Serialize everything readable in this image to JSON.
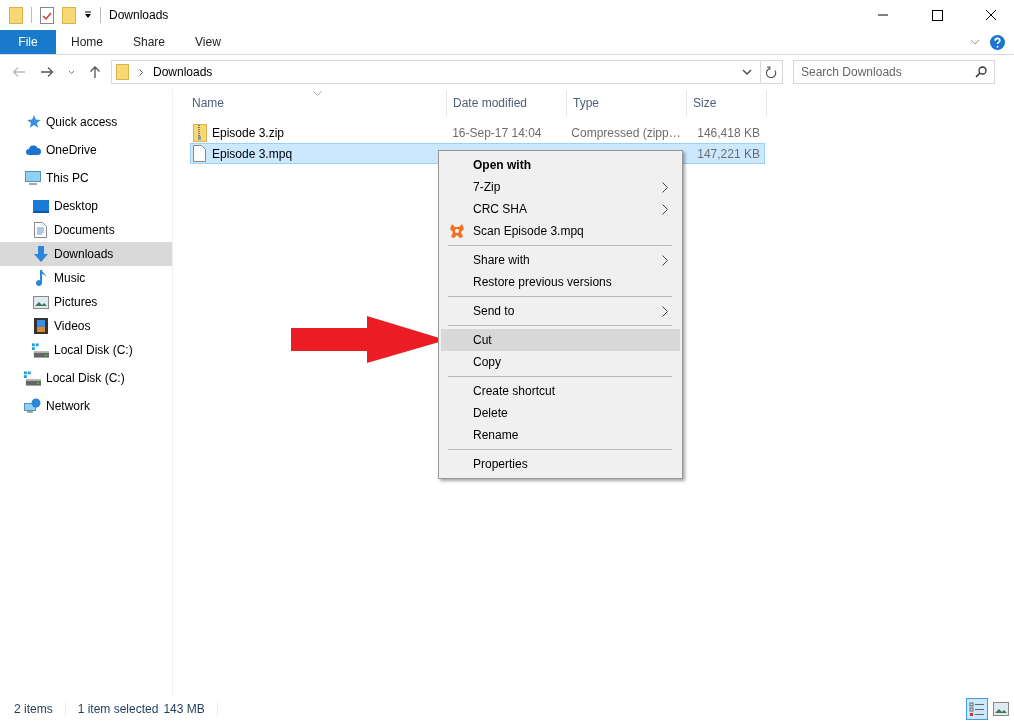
{
  "window": {
    "title": "Downloads"
  },
  "ribbon": {
    "file_tab": "File",
    "tabs": [
      "Home",
      "Share",
      "View"
    ]
  },
  "address_bar": {
    "path": "Downloads"
  },
  "search": {
    "placeholder": "Search Downloads"
  },
  "sidebar": {
    "items": [
      {
        "label": "Quick access",
        "kind": "star",
        "selected": false
      },
      {
        "label": "OneDrive",
        "kind": "cloud",
        "selected": false
      },
      {
        "label": "This PC",
        "kind": "pc",
        "selected": false,
        "children": [
          {
            "label": "Desktop",
            "kind": "desktop",
            "selected": false
          },
          {
            "label": "Documents",
            "kind": "documents",
            "selected": false
          },
          {
            "label": "Downloads",
            "kind": "downloads",
            "selected": true
          },
          {
            "label": "Music",
            "kind": "music",
            "selected": false
          },
          {
            "label": "Pictures",
            "kind": "pictures",
            "selected": false
          },
          {
            "label": "Videos",
            "kind": "videos",
            "selected": false
          },
          {
            "label": "Local Disk (C:)",
            "kind": "disk",
            "selected": false
          }
        ]
      },
      {
        "label": "Local Disk (C:)",
        "kind": "disk",
        "selected": false
      },
      {
        "label": "Network",
        "kind": "network",
        "selected": false
      }
    ]
  },
  "table": {
    "columns": [
      "Name",
      "Date modified",
      "Type",
      "Size"
    ],
    "rows": [
      {
        "kind": "zip",
        "name": "Episode 3.zip",
        "date": "16-Sep-17 14:04",
        "type": "Compressed (zipp…",
        "size": "146,418 KB",
        "selected": false
      },
      {
        "kind": "file",
        "name": "Episode 3.mpq",
        "size": "147,221 KB",
        "selected": true
      }
    ]
  },
  "context_menu": {
    "groups": [
      {
        "items": [
          {
            "label": "Open with",
            "kind": "text",
            "default": true,
            "submenu": false,
            "selected": false
          },
          {
            "label": "7-Zip",
            "kind": "text",
            "default": false,
            "submenu": true,
            "selected": false
          },
          {
            "label": "CRC SHA",
            "kind": "text",
            "default": false,
            "submenu": true,
            "selected": false
          },
          {
            "label": "Scan Episode 3.mpq",
            "kind": "scan",
            "default": false,
            "submenu": false,
            "selected": false
          }
        ]
      },
      {
        "items": [
          {
            "label": "Share with",
            "kind": "text",
            "default": false,
            "submenu": true,
            "selected": false
          },
          {
            "label": "Restore previous versions",
            "kind": "text",
            "default": false,
            "submenu": false,
            "selected": false
          }
        ]
      },
      {
        "items": [
          {
            "label": "Send to",
            "kind": "text",
            "default": false,
            "submenu": true,
            "selected": false
          }
        ]
      },
      {
        "items": [
          {
            "label": "Cut",
            "kind": "text",
            "default": false,
            "submenu": false,
            "selected": true
          },
          {
            "label": "Copy",
            "kind": "text",
            "default": false,
            "submenu": false,
            "selected": false
          }
        ]
      },
      {
        "items": [
          {
            "label": "Create shortcut",
            "kind": "text",
            "default": false,
            "submenu": false,
            "selected": false
          },
          {
            "label": "Delete",
            "kind": "text",
            "default": false,
            "submenu": false,
            "selected": false
          },
          {
            "label": "Rename",
            "kind": "text",
            "default": false,
            "submenu": false,
            "selected": false
          }
        ]
      },
      {
        "items": [
          {
            "label": "Properties",
            "kind": "text",
            "default": false,
            "submenu": false,
            "selected": false
          }
        ]
      }
    ]
  },
  "status_bar": {
    "count": "2 items",
    "selection": "1 item selected",
    "size": "143 MB"
  },
  "view_buttons": [
    {
      "kind": "details",
      "selected": true
    },
    {
      "kind": "large_icons",
      "selected": false
    }
  ]
}
